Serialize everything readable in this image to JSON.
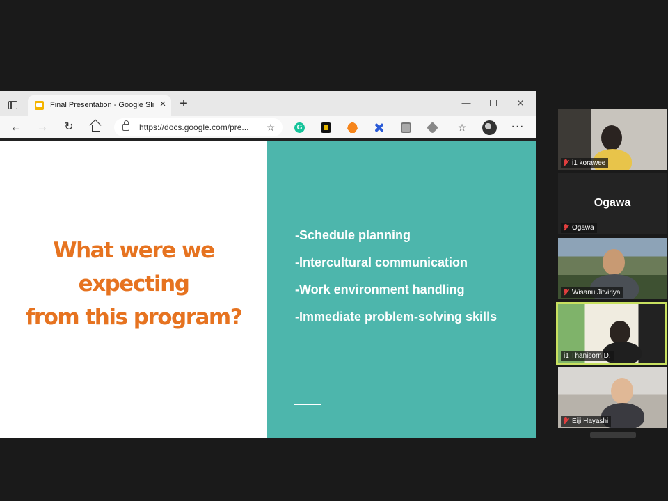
{
  "browser": {
    "tab_title": "Final Presentation - Google Slides",
    "url": "https://docs.google.com/pre...",
    "new_tab": "+",
    "close": "×",
    "minimize": "—",
    "window_close": "✕",
    "more": "···"
  },
  "slide": {
    "title_lines": [
      "What were we",
      "expecting",
      "from this program?"
    ],
    "bullets": [
      "-Schedule planning",
      "-Intercultural communication",
      "-Work environment handling",
      "-Immediate problem-solving skills"
    ],
    "colors": {
      "title": "#e67320",
      "panel": "#4db6ac"
    }
  },
  "participants": [
    {
      "name": "i1 korawee",
      "muted": true
    },
    {
      "name": "Ogawa",
      "display_name": "Ogawa",
      "muted": true
    },
    {
      "name": "Wisanu Jitviriya",
      "muted": true
    },
    {
      "name": "i1 Thanisorn D.",
      "muted": false,
      "active_speaker": true
    },
    {
      "name": "Eiji Hayashi",
      "muted": true
    }
  ],
  "icons": [
    "tab-actions-icon",
    "slides-icon",
    "back-icon",
    "forward-icon",
    "reload-icon",
    "home-icon",
    "lock-icon",
    "favorite-add-icon",
    "grammarly-icon",
    "metamask-icon",
    "favorites-icon",
    "profile-avatar",
    "more-icon",
    "mic-muted-icon"
  ]
}
